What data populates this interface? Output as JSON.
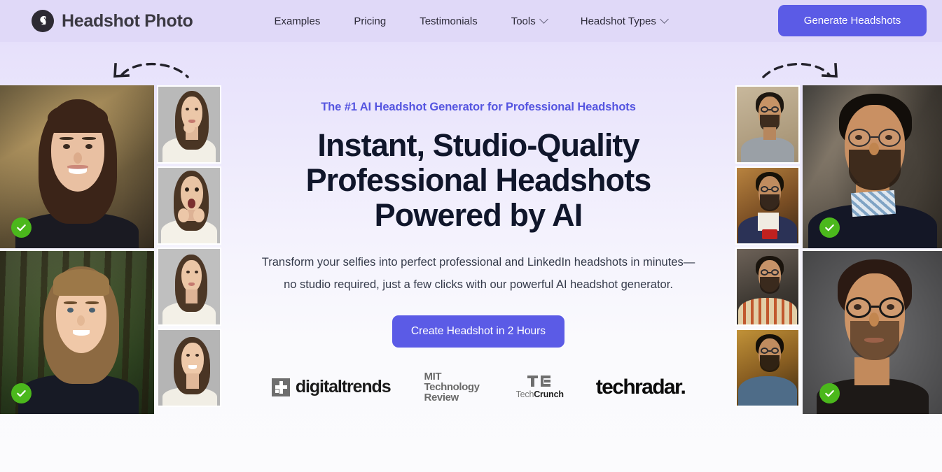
{
  "header": {
    "brand": {
      "name": "Headshot Photo",
      "logo_icon": "swan-logo-icon"
    },
    "nav": [
      {
        "label": "Examples",
        "has_dropdown": false
      },
      {
        "label": "Pricing",
        "has_dropdown": false
      },
      {
        "label": "Testimonials",
        "has_dropdown": false
      },
      {
        "label": "Tools",
        "has_dropdown": true
      },
      {
        "label": "Headshot Types",
        "has_dropdown": true
      }
    ],
    "cta_label": "Generate Headshots"
  },
  "hero": {
    "eyebrow": "The #1 AI Headshot Generator for Professional Headshots",
    "headline_line1": "Instant, Studio-Quality",
    "headline_line2": "Professional Headshots",
    "headline_line3": "Powered by AI",
    "subhead": "Transform your selfies into perfect professional and LinkedIn headshots in minutes—no studio required, just a few clicks with our powerful AI headshot generator.",
    "cta_label": "Create Headshot in 2 Hours"
  },
  "press": {
    "digitaltrends": {
      "word": "digitaltrends",
      "registered": "®"
    },
    "mit": {
      "line1": "MIT",
      "line2": "Technology",
      "line3": "Review"
    },
    "techcrunch": {
      "prefix": "Tech",
      "suffix": "Crunch"
    },
    "techradar": {
      "word": "techradar."
    }
  },
  "gallery": {
    "badge_icon": "green-check-icon",
    "left": {
      "large": [
        {
          "alt": "woman-headshot-autumn-background",
          "selected": true
        },
        {
          "alt": "woman-headshot-forest-background",
          "selected": true
        }
      ],
      "thumbs": [
        {
          "alt": "woman-selfie-thinking"
        },
        {
          "alt": "woman-selfie-surprised"
        },
        {
          "alt": "woman-selfie-looking-side"
        },
        {
          "alt": "woman-selfie-smiling"
        }
      ]
    },
    "right": {
      "thumbs": [
        {
          "alt": "man-selfie-grey-shirt"
        },
        {
          "alt": "man-selfie-varsity-jacket"
        },
        {
          "alt": "man-selfie-striped-shirt"
        },
        {
          "alt": "man-selfie-blue-kurta"
        }
      ],
      "large": [
        {
          "alt": "man-headshot-office-background",
          "selected": true
        },
        {
          "alt": "man-headshot-grey-background",
          "selected": true
        }
      ]
    }
  },
  "decor": {
    "arrow_left": "dashed-arrow-pointing-left",
    "arrow_right": "dashed-arrow-pointing-right"
  },
  "colors": {
    "accent": "#5b5be6",
    "eyebrow": "#5555e0",
    "headline": "#10162b",
    "header_bg": "#e0d9f8",
    "badge_green": "#4bb81c"
  }
}
